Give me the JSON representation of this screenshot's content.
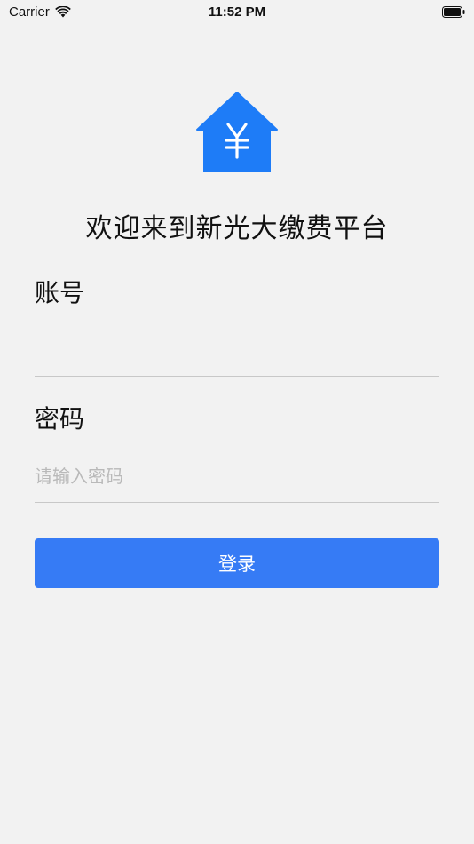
{
  "status_bar": {
    "carrier": "Carrier",
    "time": "11:52 PM",
    "wifi_icon": "wifi-icon",
    "battery_icon": "battery-icon"
  },
  "logo": {
    "icon": "house-yen-icon",
    "color": "#1e7cf7"
  },
  "title": "欢迎来到新光大缴费平台",
  "form": {
    "account_label": "账号",
    "account_value": "",
    "password_label": "密码",
    "password_value": "",
    "password_placeholder": "请输入密码",
    "login_label": "登录"
  },
  "colors": {
    "background": "#f2f2f2",
    "accent": "#367bf5",
    "divider": "#c8c8c8",
    "placeholder": "#b9b9b9"
  }
}
